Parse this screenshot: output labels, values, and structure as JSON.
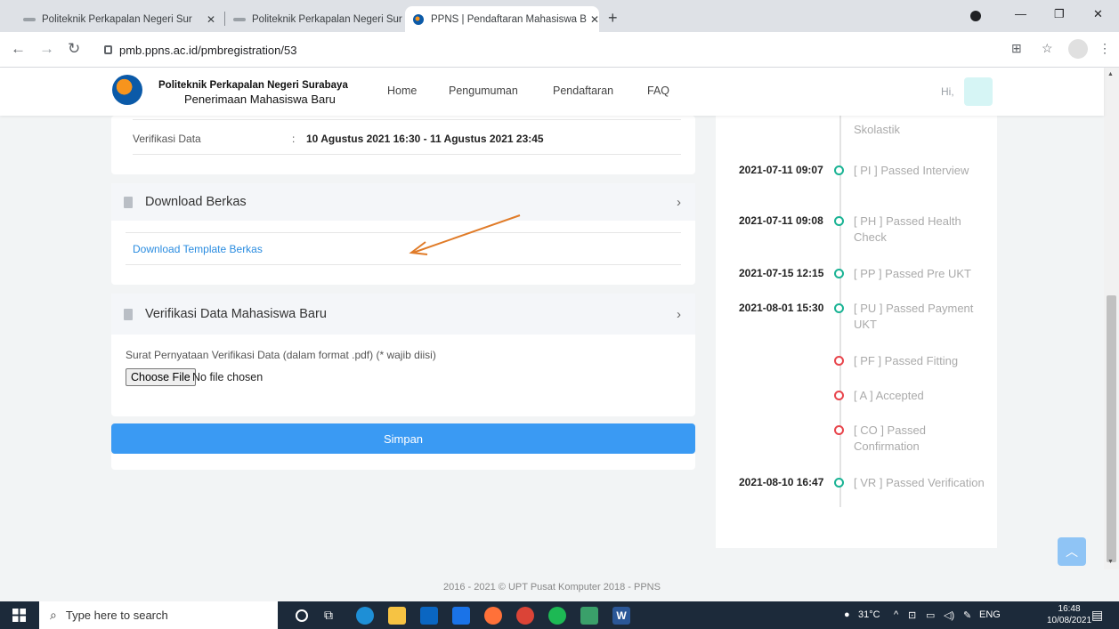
{
  "browser": {
    "tabs": [
      {
        "label": "Politeknik Perkapalan Negeri Sur"
      },
      {
        "label": "Politeknik Perkapalan Negeri Sur"
      },
      {
        "label": "PPNS | Pendaftaran Mahasiswa B"
      }
    ],
    "url": "pmb.ppns.ac.id/pmbregistration/53"
  },
  "header": {
    "brand_line1": "Politeknik Perkapalan Negeri Surabaya",
    "brand_line2": "Penerimaan Mahasiswa Baru",
    "nav": [
      "Home",
      "Pengumuman",
      "Pendaftaran",
      "FAQ"
    ],
    "greeting": "Hi,"
  },
  "schedule": {
    "label": "Verifikasi Data",
    "separator": ":",
    "value": "10 Agustus 2021 16:30 - 11 Agustus 2021 23:45"
  },
  "download": {
    "title": "Download Berkas",
    "link": "Download Template Berkas"
  },
  "verification": {
    "title": "Verifikasi Data Mahasiswa Baru",
    "field_label": "Surat Pernyataan Verifikasi Data (dalam format .pdf) (* wajib diisi)",
    "file_button": "Choose File",
    "file_status": "No file chosen",
    "submit": "Simpan"
  },
  "timeline": [
    {
      "date": "",
      "text": "Skolastik",
      "status": "green"
    },
    {
      "date": "2021-07-11 09:07",
      "text": "[ PI ] Passed Interview",
      "status": "green"
    },
    {
      "date": "2021-07-11 09:08",
      "text": "[ PH ] Passed Health Check",
      "status": "green"
    },
    {
      "date": "2021-07-15 12:15",
      "text": "[ PP ] Passed Pre UKT",
      "status": "green"
    },
    {
      "date": "2021-08-01 15:30",
      "text": "[ PU ] Passed Payment UKT",
      "status": "green"
    },
    {
      "date": "",
      "text": "[ PF ] Passed Fitting",
      "status": "red"
    },
    {
      "date": "",
      "text": "[ A ] Accepted",
      "status": "red"
    },
    {
      "date": "",
      "text": "[ CO ] Passed Confirmation",
      "status": "red"
    },
    {
      "date": "2021-08-10 16:47",
      "text": "[ VR ] Passed Verification",
      "status": "green"
    }
  ],
  "footer": "2016 - 2021 ©  UPT Pusat Komputer 2018 - PPNS",
  "taskbar": {
    "search_placeholder": "Type here to search",
    "weather": "31°C",
    "lang": "ENG",
    "time": "16:48",
    "date": "10/08/2021"
  },
  "colors": {
    "accent": "#3a9af3",
    "timeline_done": "#1ab394",
    "timeline_pending": "#e8454c",
    "annotation_arrow": "#e07b28"
  }
}
